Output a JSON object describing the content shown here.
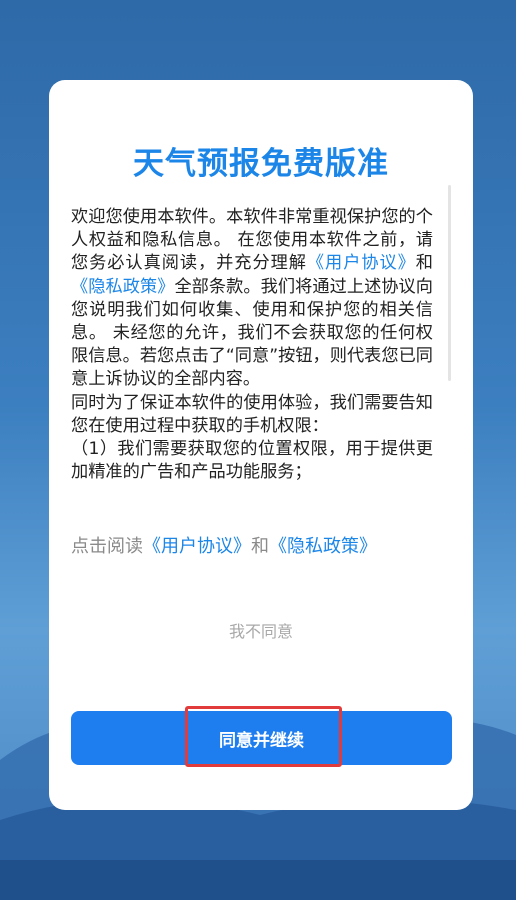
{
  "dialog": {
    "title": "天气预报免费版准",
    "body": {
      "p1_a": "欢迎您使用本软件。本软件非常重视保护您的个人权益和隐私信息。 在您使用本软件之前，请您务必认真阅读，并充分理解",
      "p1_link1": "《用户协议》",
      "p1_and": "和",
      "p1_link2": "《隐私政策》",
      "p1_b": "全部条款。我们将通过上述协议向您说明我们如何收集、使用和保护您的相关信息。 未经您的允许，我们不会获取您的任何权限信息。若您点击了“同意”按钮，则代表您已同意上诉协议的全部内容。",
      "p2": " 同时为了保证本软件的使用体验，我们需要告知您在使用过程中获取的手机权限：",
      "p3": "（1）我们需要获取您的位置权限，用于提供更加精准的广告和产品功能服务；"
    },
    "agreement_line": {
      "prefix": "点击阅读",
      "link1": "《用户协议》",
      "and": "和",
      "link2": "《隐私政策》"
    },
    "decline_label": "我不同意",
    "accept_label": "同意并继续"
  },
  "colors": {
    "accent": "#1c86e8",
    "button": "#1e7ef0",
    "highlight": "#e23b3b"
  }
}
